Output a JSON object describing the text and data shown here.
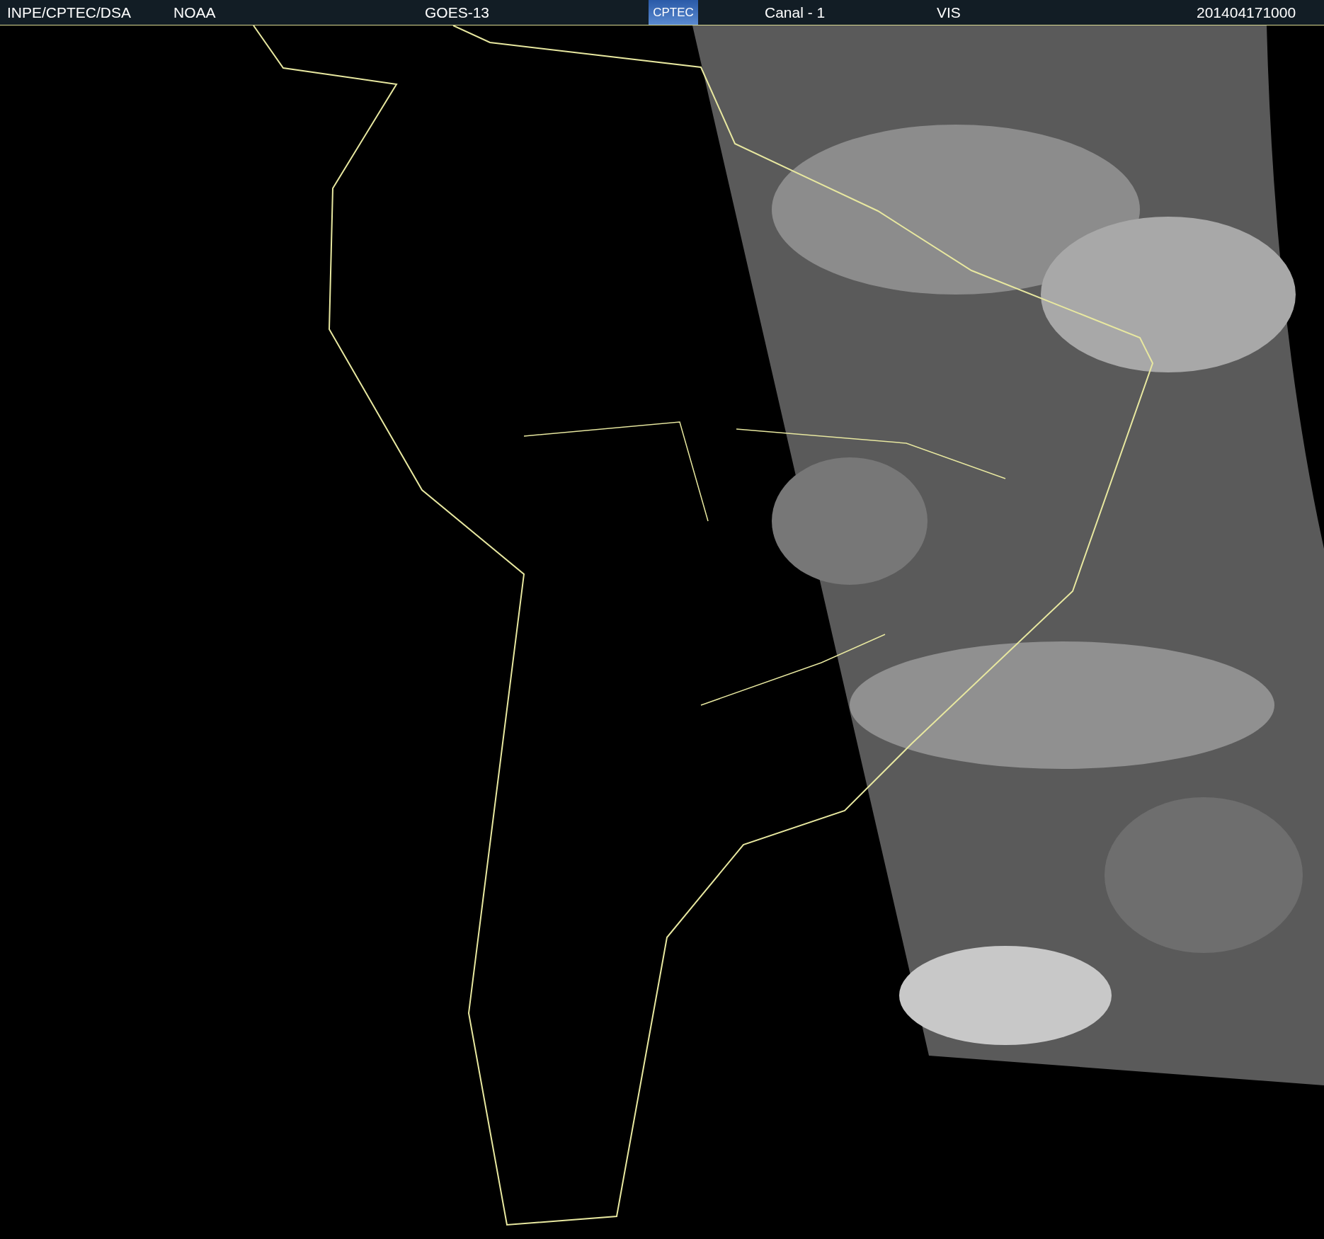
{
  "header": {
    "source": "INPE/CPTEC/DSA",
    "agency": "NOAA",
    "satellite": "GOES-13",
    "logo_text": "CPTEC",
    "channel": "Canal - 1",
    "band": "VIS",
    "timestamp": "201404171000"
  }
}
